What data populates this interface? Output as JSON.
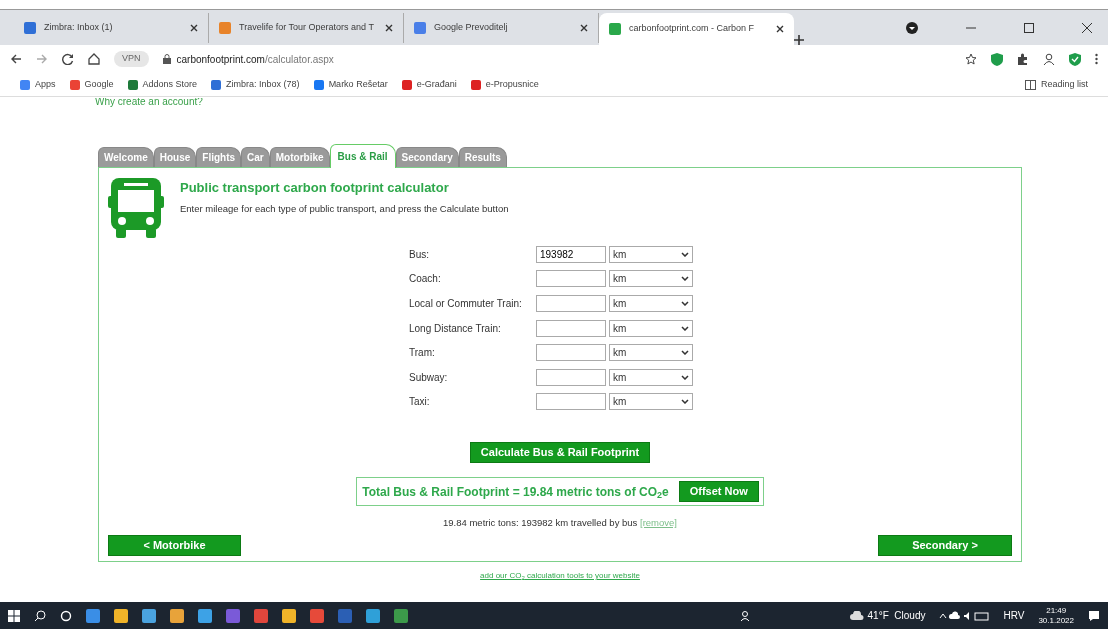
{
  "browser": {
    "tabs": [
      {
        "title": "Zimbra: Inbox (1)",
        "selected": false,
        "color": "#2f6fd6"
      },
      {
        "title": "Travelife for Tour Operators and T",
        "selected": false,
        "color": "#e8832a"
      },
      {
        "title": "Google Prevoditelj",
        "selected": false,
        "color": "#4a7fe8"
      },
      {
        "title": "carbonfootprint.com - Carbon F",
        "selected": true,
        "color": "#2aa84a"
      }
    ],
    "address": {
      "badge": "VPN",
      "host": "carbonfootprint.com",
      "path": "/calculator.aspx"
    },
    "bookmarks": [
      {
        "label": "Apps",
        "color": "#4285f4"
      },
      {
        "label": "Google",
        "color": "#ea4335"
      },
      {
        "label": "Addons Store",
        "color": "#1e7a3a"
      },
      {
        "label": "Zimbra: Inbox (78)",
        "color": "#2f6fd6"
      },
      {
        "label": "Marko Rešetar",
        "color": "#1877f2"
      },
      {
        "label": "e-Građani",
        "color": "#d22"
      },
      {
        "label": "e-Propusnice",
        "color": "#d22"
      }
    ],
    "reading_list": "Reading list"
  },
  "page": {
    "intro_link": "Why create an account?",
    "tabs": [
      {
        "label": "Welcome",
        "selected": false
      },
      {
        "label": "House",
        "selected": false
      },
      {
        "label": "Flights",
        "selected": false
      },
      {
        "label": "Car",
        "selected": false
      },
      {
        "label": "Motorbike",
        "selected": false
      },
      {
        "label": "Bus & Rail",
        "selected": true
      },
      {
        "label": "Secondary",
        "selected": false
      },
      {
        "label": "Results",
        "selected": false
      }
    ],
    "title": "Public transport carbon footprint calculator",
    "instructions": "Enter mileage for each type of public transport, and press the Calculate button",
    "rows": [
      {
        "label": "Bus:",
        "value": "193982",
        "unit": "km"
      },
      {
        "label": "Coach:",
        "unit": "km"
      },
      {
        "label": "Local or Commuter Train:",
        "unit": "km"
      },
      {
        "label": "Long Distance Train:",
        "unit": "km"
      },
      {
        "label": "Tram:",
        "unit": "km"
      },
      {
        "label": "Subway:",
        "unit": "km"
      },
      {
        "label": "Taxi:",
        "unit": "km"
      }
    ],
    "calculate_button": "Calculate Bus & Rail Footprint",
    "total": {
      "text": "Total Bus & Rail Footprint = 19.84 metric tons of CO$_{2}$e",
      "button": "Offset Now"
    },
    "result": {
      "text": "19.84 metric tons: 193982 km travelled by bus",
      "link": "[remove]"
    },
    "prev_button": "< Motorbike",
    "next_button": "Secondary >",
    "footer_link": "add our CO$_{2}$ calculation tools to your website"
  },
  "taskbar": {
    "weather": "41°F  Cloudy",
    "language": "HRV",
    "time": "21:49",
    "date": "30.1.2022"
  }
}
